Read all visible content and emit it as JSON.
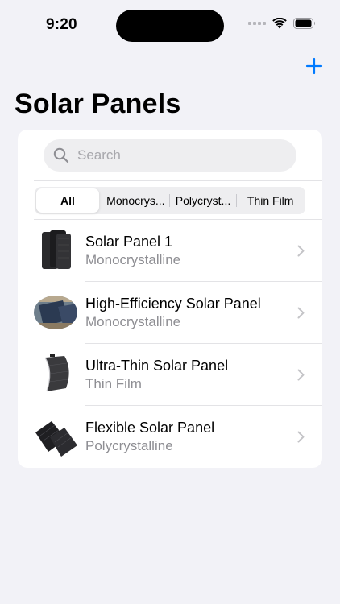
{
  "status_bar": {
    "time": "9:20"
  },
  "nav": {
    "title": "Solar Panels",
    "add_icon": "plus-icon"
  },
  "search": {
    "placeholder": "Search",
    "value": ""
  },
  "filter": {
    "segments": [
      {
        "label": "All",
        "selected": true
      },
      {
        "label": "Monocrys...",
        "selected": false
      },
      {
        "label": "Polycryst...",
        "selected": false
      },
      {
        "label": "Thin Film",
        "selected": false
      }
    ]
  },
  "panels": [
    {
      "name": "Solar Panel 1",
      "type": "Monocrystalline"
    },
    {
      "name": "High-Efficiency Solar Panel",
      "type": "Monocrystalline"
    },
    {
      "name": "Ultra-Thin Solar Panel",
      "type": "Thin Film"
    },
    {
      "name": "Flexible Solar Panel",
      "type": "Polycrystalline"
    }
  ],
  "colors": {
    "accent": "#007aff",
    "background": "#f2f2f7",
    "secondary_text": "#8e8e93"
  }
}
